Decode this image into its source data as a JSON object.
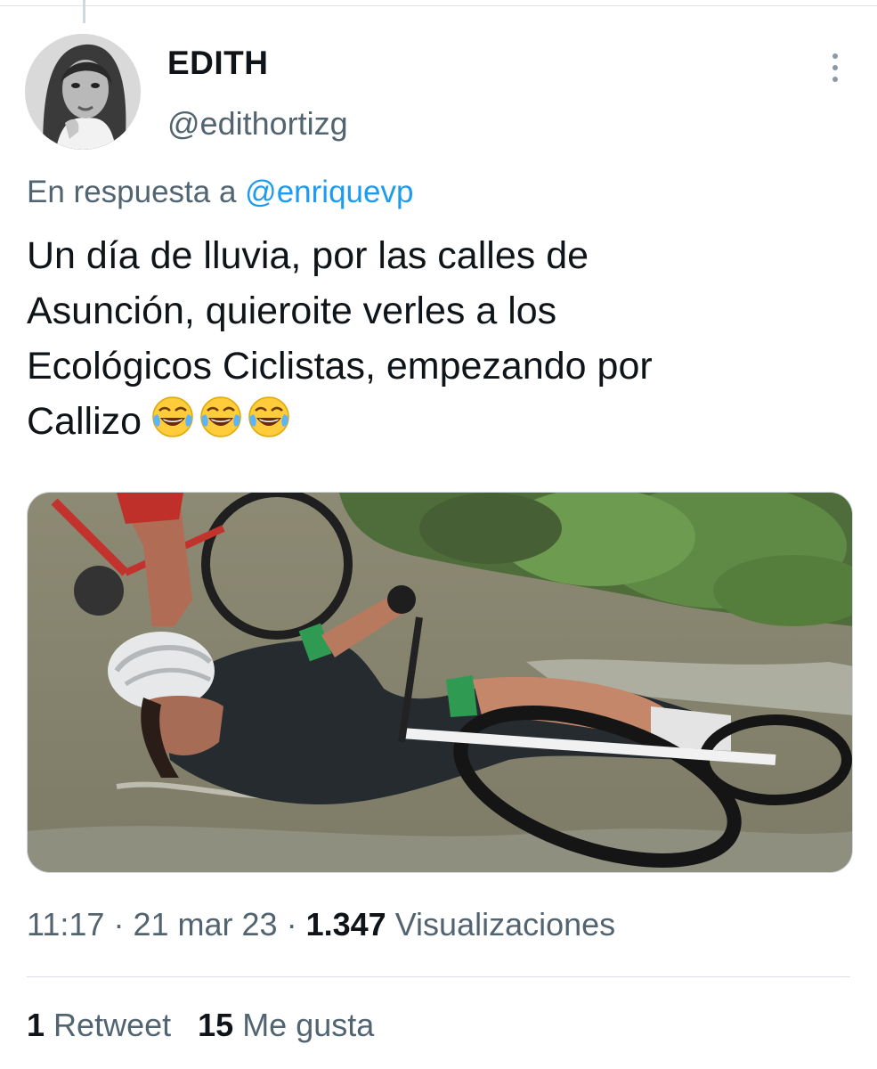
{
  "author": {
    "name": "EDITH",
    "handle": "@edithortizg"
  },
  "reply": {
    "prefix": "En respuesta a",
    "mention": "@enriquevp"
  },
  "tweet": {
    "text": "Un día de lluvia, por las calles de\nAsunción,  quieroite verles a los\nEcológicos Ciclistas, empezando por\nCallizo",
    "emojis": [
      "face-with-tears-of-joy-icon",
      "face-with-tears-of-joy-icon",
      "face-with-tears-of-joy-icon"
    ]
  },
  "meta": {
    "time": "11:17",
    "date": "21 mar 23",
    "views_count": "1.347",
    "views_label": "Visualizaciones",
    "separator": "·"
  },
  "stats": {
    "retweets_count": "1",
    "retweets_label": "Retweet",
    "likes_count": "15",
    "likes_label": "Me gusta"
  },
  "colors": {
    "text": "#0f1419",
    "secondary": "#536471",
    "link": "#1d9bf0",
    "divider": "#dbe1e6"
  }
}
